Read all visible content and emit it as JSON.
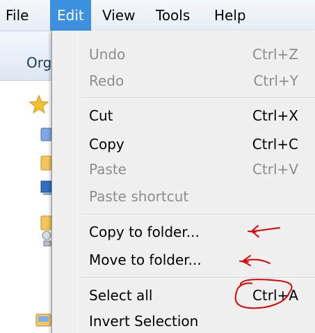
{
  "menubar": {
    "items": [
      {
        "label": "File"
      },
      {
        "label": "Edit"
      },
      {
        "label": "View"
      },
      {
        "label": "Tools"
      },
      {
        "label": "Help"
      }
    ]
  },
  "toolbar": {
    "organize_label": "Organize"
  },
  "nav_icons": [
    "favorites-star-icon",
    "desktop-icon",
    "folder-icon",
    "computer-icon",
    "folder-icon",
    "network-icon",
    "libraries-icon"
  ],
  "edit_menu": {
    "items": [
      {
        "label": "Undo",
        "shortcut": "Ctrl+Z",
        "enabled": false
      },
      {
        "label": "Redo",
        "shortcut": "Ctrl+Y",
        "enabled": false
      },
      {
        "label": "Cut",
        "shortcut": "Ctrl+X",
        "enabled": true
      },
      {
        "label": "Copy",
        "shortcut": "Ctrl+C",
        "enabled": true
      },
      {
        "label": "Paste",
        "shortcut": "Ctrl+V",
        "enabled": false
      },
      {
        "label": "Paste shortcut",
        "shortcut": "",
        "enabled": false
      },
      {
        "label": "Copy to folder...",
        "shortcut": "",
        "enabled": true
      },
      {
        "label": "Move to folder...",
        "shortcut": "",
        "enabled": true
      },
      {
        "label": "Select all",
        "shortcut": "Ctrl+A",
        "enabled": true
      },
      {
        "label": "Invert Selection",
        "shortcut": "",
        "enabled": true
      }
    ]
  },
  "colors": {
    "menu_highlight": "#3d8fe0",
    "menu_background": "#f0f0f0",
    "disabled_text": "#8d8d8d",
    "annotation_red": "#e00000"
  }
}
